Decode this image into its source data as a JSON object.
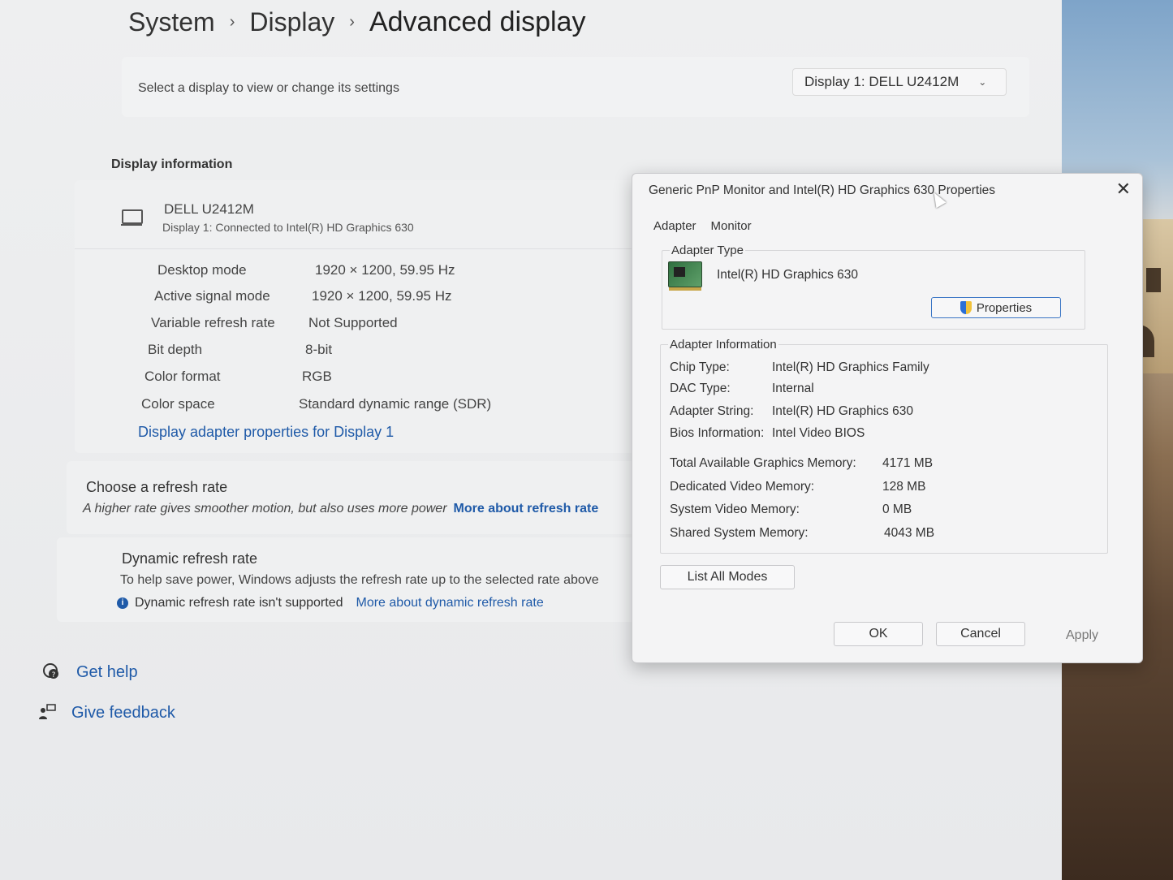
{
  "breadcrumb": {
    "items": [
      "System",
      "Display"
    ],
    "current": "Advanced display",
    "separator": "›"
  },
  "select_bar": {
    "label": "Select a display to view or change its settings",
    "dropdown_value": "Display 1: DELL U2412M"
  },
  "display_info": {
    "section_title": "Display information",
    "monitor_name": "DELL U2412M",
    "monitor_sub": "Display 1: Connected to Intel(R) HD Graphics 630",
    "specs": [
      {
        "key": "Desktop mode",
        "value": "1920 × 1200, 59.95 Hz"
      },
      {
        "key": "Active signal mode",
        "value": "1920 × 1200, 59.95 Hz"
      },
      {
        "key": "Variable refresh rate",
        "value": "Not Supported"
      },
      {
        "key": "Bit depth",
        "value": "8-bit"
      },
      {
        "key": "Color format",
        "value": "RGB"
      },
      {
        "key": "Color space",
        "value": "Standard dynamic range (SDR)"
      }
    ],
    "adapter_link": "Display adapter properties for Display 1"
  },
  "refresh": {
    "title": "Choose a refresh rate",
    "desc": "A higher rate gives smoother motion, but also uses more power",
    "link": "More about refresh rate"
  },
  "dynamic": {
    "title": "Dynamic refresh rate",
    "desc": "To help save power, Windows adjusts the refresh rate up to the selected rate above",
    "note": "Dynamic refresh rate isn't supported",
    "link": "More about dynamic refresh rate"
  },
  "help": {
    "get_help": "Get help",
    "give_feedback": "Give feedback"
  },
  "dialog": {
    "title": "Generic PnP Monitor and Intel(R) HD Graphics 630 Properties",
    "close_glyph": "✕",
    "tabs": [
      "Adapter",
      "Monitor"
    ],
    "adapter_type_label": "Adapter Type",
    "adapter_name": "Intel(R) HD Graphics 630",
    "properties_button": "Properties",
    "adapter_info_label": "Adapter Information",
    "adapter_info": [
      {
        "key": "Chip Type:",
        "value": "Intel(R) HD Graphics Family"
      },
      {
        "key": "DAC Type:",
        "value": "Internal"
      },
      {
        "key": "Adapter String:",
        "value": "Intel(R) HD Graphics 630"
      },
      {
        "key": "Bios Information:",
        "value": "Intel Video BIOS"
      }
    ],
    "memory": [
      {
        "key": "Total Available Graphics Memory:",
        "value": "4171 MB"
      },
      {
        "key": "Dedicated Video Memory:",
        "value": "128 MB"
      },
      {
        "key": "System Video Memory:",
        "value": "0 MB"
      },
      {
        "key": "Shared System Memory:",
        "value": "4043 MB"
      }
    ],
    "list_modes_button": "List All Modes",
    "ok_button": "OK",
    "cancel_button": "Cancel",
    "apply_button": "Apply"
  },
  "colors": {
    "link": "#1f5aa8",
    "button_accent": "#3b76c5"
  },
  "icons": [
    "monitor-icon",
    "chevron-down-icon",
    "info-icon",
    "get-help-icon",
    "feedback-icon",
    "close-icon",
    "graphics-card-icon",
    "uac-shield-icon",
    "mouse-cursor-icon"
  ]
}
